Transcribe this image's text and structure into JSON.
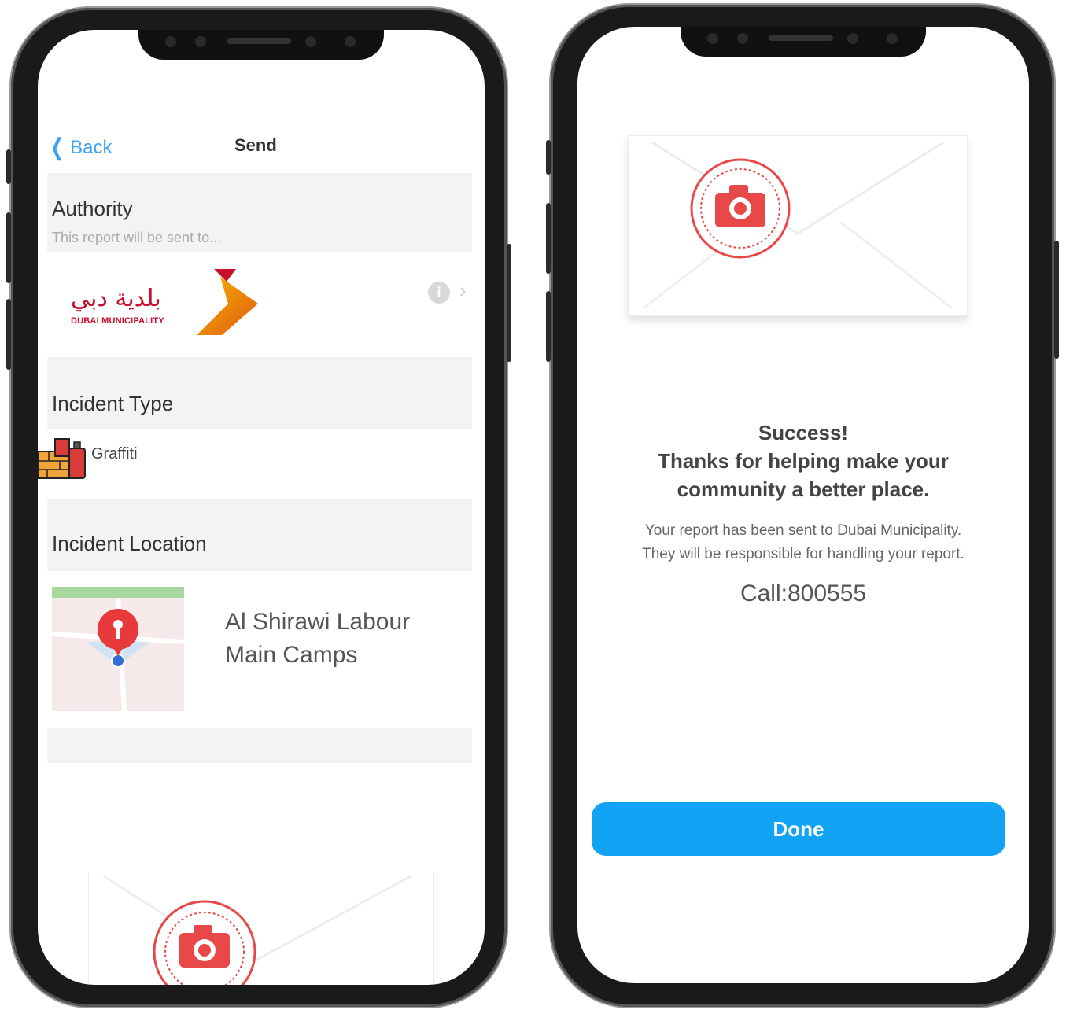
{
  "left_screen": {
    "nav": {
      "back_label": "Back",
      "title": "Send"
    },
    "authority": {
      "title": "Authority",
      "subtitle": "This report will be sent to...",
      "logo_arabic": "بلدية دبي",
      "logo_english": "DUBAI MUNICIPALITY"
    },
    "incident_type": {
      "title": "Incident Type",
      "value": "Graffiti"
    },
    "incident_location": {
      "title": "Incident Location",
      "line1": "Al Shirawi Labour",
      "line2": "Main Camps"
    }
  },
  "right_screen": {
    "success_line1": "Success!",
    "success_line2": "Thanks for helping make your",
    "success_line3": "community a better place.",
    "body_line1": "Your report has been sent to Dubai Municipality.",
    "body_line2": "They will be responsible for handling your report.",
    "call": "Call:800555",
    "done_label": "Done"
  },
  "colors": {
    "accent_blue": "#12a3f5",
    "link_blue": "#3aa3f3",
    "stamp_red": "#e84848",
    "brand_red": "#c8102e"
  },
  "icons": [
    "chevron-left-icon",
    "info-icon",
    "chevron-right-icon",
    "graffiti-icon",
    "map-pin-icon",
    "camera-stamp-icon",
    "envelope-icon"
  ]
}
